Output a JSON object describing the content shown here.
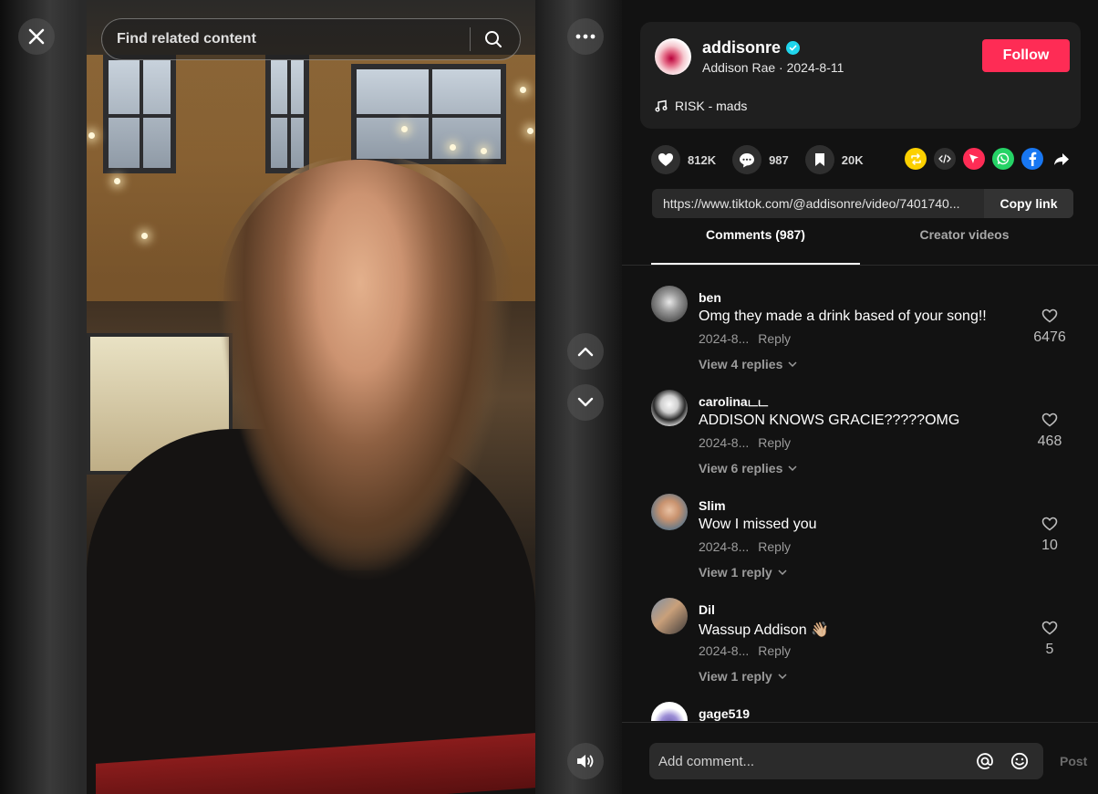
{
  "search": {
    "placeholder": "Find related content"
  },
  "author": {
    "username": "addisonre",
    "display_line": "Addison Rae · 2024-8-11",
    "follow_label": "Follow",
    "music": "RISK - mads"
  },
  "stats": {
    "likes": "812K",
    "comments": "987",
    "saves": "20K"
  },
  "share": {
    "link": "https://www.tiktok.com/@addisonre/video/7401740...",
    "copy_label": "Copy link",
    "icons": [
      "repost-icon",
      "embed-icon",
      "send-icon",
      "whatsapp-icon",
      "facebook-icon",
      "share-arrow-icon"
    ]
  },
  "tabs": [
    {
      "label": "Comments (987)",
      "active": true
    },
    {
      "label": "Creator videos",
      "active": false
    }
  ],
  "comments": [
    {
      "user": "ben",
      "text": "Omg they made a drink based of your song!!",
      "date": "2024-8...",
      "reply_label": "Reply",
      "likes": "6476",
      "view_replies": "View 4 replies"
    },
    {
      "user": "carolinaடட",
      "text": "ADDISON KNOWS GRACIE?????OMG",
      "date": "2024-8...",
      "reply_label": "Reply",
      "likes": "468",
      "view_replies": "View 6 replies"
    },
    {
      "user": "Slim",
      "text": "Wow I missed you",
      "date": "2024-8...",
      "reply_label": "Reply",
      "likes": "10",
      "view_replies": "View 1 reply"
    },
    {
      "user": "Dil",
      "text": "Wassup Addison 👋🏼",
      "date": "2024-8...",
      "reply_label": "Reply",
      "likes": "5",
      "view_replies": "View 1 reply"
    },
    {
      "user": "gage519",
      "text": "",
      "date": "",
      "reply_label": "",
      "likes": "",
      "view_replies": ""
    }
  ],
  "comment_box": {
    "placeholder": "Add comment...",
    "post_label": "Post"
  },
  "colors": {
    "accent": "#fe2c55",
    "verified": "#20d5ec",
    "panel_bg": "#121212",
    "card_bg": "#1f1f1f"
  }
}
